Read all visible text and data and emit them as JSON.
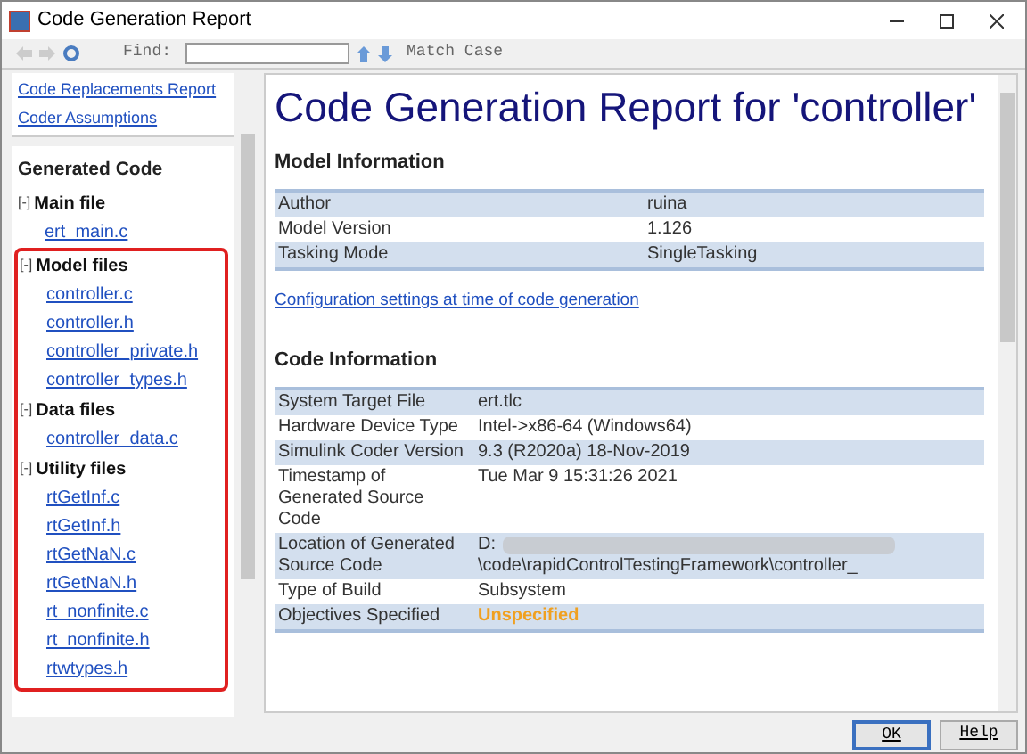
{
  "window": {
    "title": "Code Generation Report"
  },
  "toolbar": {
    "find_label": "Find:",
    "match_case": "Match Case"
  },
  "nav_links": [
    "Code Replacements Report",
    "Coder Assumptions"
  ],
  "generated_code": {
    "title": "Generated Code",
    "groups": [
      {
        "toggle": "[-]",
        "label": "Main file",
        "children": [
          "ert_main.c"
        ]
      }
    ],
    "highlight_box": {
      "groups": [
        {
          "toggle": "[-]",
          "label": "Model files",
          "children": [
            "controller.c",
            "controller.h",
            "controller_private.h",
            "controller_types.h"
          ]
        },
        {
          "toggle": "[-]",
          "label": "Data files",
          "children": [
            "controller_data.c"
          ]
        },
        {
          "toggle": "[-]",
          "label": "Utility files",
          "children": [
            "rtGetInf.c",
            "rtGetInf.h",
            "rtGetNaN.c",
            "rtGetNaN.h",
            "rt_nonfinite.c",
            "rt_nonfinite.h",
            "rtwtypes.h"
          ]
        }
      ]
    }
  },
  "report": {
    "title": "Code Generation Report for 'controller'",
    "model_information": {
      "heading": "Model Information",
      "rows": [
        {
          "label": "Author",
          "value": [
            "ruina"
          ],
          "kind": "text"
        },
        {
          "label": "Model Version",
          "value": [
            "1.126"
          ],
          "kind": "text"
        },
        {
          "label": "Tasking Mode",
          "value": [
            "SingleTasking"
          ],
          "kind": "text"
        }
      ]
    },
    "config_link": "Configuration settings at time of code generation",
    "code_information": {
      "heading": "Code Information",
      "rows": [
        {
          "label": "System Target File",
          "value": [
            "ert.tlc"
          ],
          "kind": "text"
        },
        {
          "label": "Hardware Device Type",
          "value": [
            "Intel->x86-64 (Windows64)"
          ],
          "kind": "text"
        },
        {
          "label": "Simulink Coder Version",
          "value": [
            "9.3 (R2020a) 18-Nov-2019"
          ],
          "kind": "text"
        },
        {
          "label": "Timestamp of Generated Source Code",
          "value": [
            "Tue Mar 9 15:31:26 2021"
          ],
          "kind": "text"
        },
        {
          "label": "Location of Generated Source Code",
          "value": [
            "D:",
            "\\code\\rapidControlTestingFramework\\controller_"
          ],
          "kind": "redacted"
        },
        {
          "label": "Type of Build",
          "value": [
            "Subsystem"
          ],
          "kind": "text"
        },
        {
          "label": "Objectives Specified",
          "value": [
            "Unspecified"
          ],
          "kind": "warning"
        }
      ]
    }
  },
  "buttons": [
    "OK",
    "Help"
  ]
}
